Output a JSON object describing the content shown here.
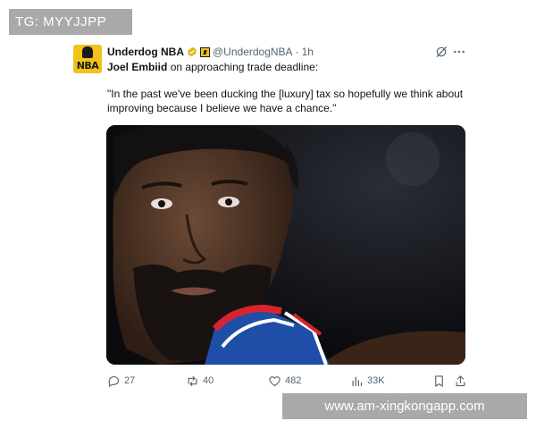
{
  "watermark_top": "TG: MYYJJPP",
  "watermark_bottom": "www.am-xingkongapp.com",
  "post": {
    "avatar_text": "NBA",
    "author_name": "Underdog NBA",
    "handle": "@UnderdogNBA",
    "separator": "·",
    "time": "1h",
    "line1_subject": "Joel Embiid",
    "line1_rest": " on approaching trade deadline:",
    "quote": "\"In the past we've been ducking the [luxury] tax so hopefully we think about improving because I believe we have a chance.\"",
    "image_icon": "player-photo",
    "stats": {
      "replies": "27",
      "reposts": "40",
      "likes": "482",
      "views": "33K"
    }
  },
  "icons": {
    "verified": "verified-badge-icon",
    "affiliate": "affiliate-badge-icon",
    "grok": "grok-icon",
    "more": "more-icon",
    "reply": "reply-icon",
    "repost": "repost-icon",
    "like": "heart-icon",
    "views": "views-icon",
    "bookmark": "bookmark-icon",
    "share": "share-icon"
  },
  "colors": {
    "text": "#0f1419",
    "secondary": "#536471",
    "verified_gold": "#e2b719",
    "brand_yellow": "#f2c21b",
    "watermark_bg": "#a9a9a9"
  }
}
